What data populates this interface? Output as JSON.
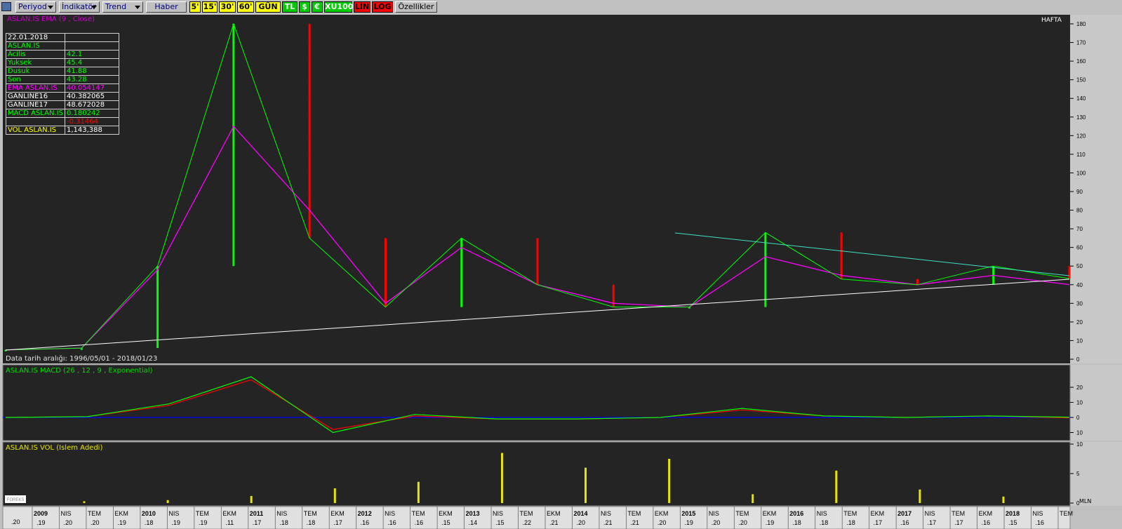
{
  "toolbar": {
    "periyod": "Periyod",
    "indikator": "İndikatör",
    "trend": "Trend",
    "haber": "Haber",
    "chips": [
      "5'",
      "15'",
      "30'",
      "60'",
      "GÜN",
      "TL",
      "$",
      "€",
      "XU100",
      "LİN",
      "LOG",
      "Özellikler"
    ]
  },
  "price_panel": {
    "ema_label": "ASLAN.IS EMA (9 , Close)",
    "period_label": "HAFTA",
    "date_range": "Data tarih aralığı: 1996/05/01 - 2018/01/23",
    "info": {
      "date": "22.01.2018",
      "symbol": "ASLAN.IS",
      "rows": [
        {
          "label": "Acilis",
          "value": "42.1"
        },
        {
          "label": "Yuksek",
          "value": "45.4"
        },
        {
          "label": "Dusuk",
          "value": "41.88"
        },
        {
          "label": "Son",
          "value": "43.28"
        },
        {
          "label": "EMA ASLAN.IS",
          "value": "40.054147"
        },
        {
          "label": "GANLINE16",
          "value": "40.382065"
        },
        {
          "label": "GANLINE17",
          "value": "48.672028"
        },
        {
          "label": "MACD ASLAN.IS",
          "value": "0.180242"
        },
        {
          "label": "",
          "value": "-0.31464"
        },
        {
          "label": "VOL ASLAN.IS",
          "value": "1,143,388"
        }
      ]
    }
  },
  "macd_panel": {
    "label": "ASLAN.IS MACD (26 , 12 , 9 , Exponential)"
  },
  "vol_panel": {
    "label": "ASLAN.IS VOL (Islem Adedi)",
    "unit": "MLN"
  },
  "logo_text": "FOREKS",
  "colors": {
    "bg": "#242424",
    "up": "#00ff00",
    "down": "#ff0000",
    "ema": "#ff00ff",
    "trend_white": "#ffffff",
    "trend_cyan": "#40e0c0",
    "volume": "#e6e600",
    "zero_line": "#0000ff"
  },
  "chart_data": [
    {
      "type": "line",
      "name": "price",
      "title": "ASLAN.IS EMA (9 , Close)",
      "x": [
        "2009",
        "2010",
        "2011",
        "2011",
        "2011",
        "2012",
        "2012",
        "2013",
        "2014",
        "2015",
        "2015",
        "2016",
        "2017",
        "2017",
        "2018"
      ],
      "series": [
        {
          "name": "ASLAN.IS",
          "values": [
            5,
            6,
            50,
            180,
            65,
            28,
            65,
            40,
            28,
            28,
            68,
            43,
            40,
            50,
            43.28
          ]
        },
        {
          "name": "EMA",
          "values": [
            5,
            6,
            48,
            125,
            80,
            30,
            60,
            40,
            30,
            28,
            55,
            45,
            40,
            45,
            40.05
          ]
        }
      ],
      "yticks": [
        0,
        10,
        20,
        30,
        40,
        50,
        60,
        70,
        80,
        90,
        100,
        110,
        120,
        130,
        140,
        150,
        160,
        170,
        180
      ],
      "ylim": [
        0,
        185
      ]
    },
    {
      "type": "line",
      "name": "macd",
      "title": "ASLAN.IS MACD (26 , 12 , 9 , Exponential)",
      "yticks": [
        20,
        10,
        0,
        10
      ],
      "ylim": [
        -13,
        27
      ],
      "series": [
        {
          "name": "MACD",
          "values": [
            0,
            0.5,
            9,
            27,
            -10,
            2,
            -1,
            -1,
            0,
            6,
            1,
            0,
            1,
            0.18
          ]
        },
        {
          "name": "Signal",
          "values": [
            0,
            0.5,
            8,
            25,
            -8,
            1,
            -1,
            -1,
            0,
            5,
            1,
            0,
            1,
            -0.31
          ]
        }
      ]
    },
    {
      "type": "bar",
      "name": "volume",
      "title": "ASLAN.IS VOL (Islem Adedi)",
      "yticks": [
        10,
        5,
        0
      ],
      "ylabel": "MLN",
      "ylim": [
        0,
        10
      ],
      "values": [
        0.3,
        0.5,
        1.2,
        2.5,
        3.6,
        8.5,
        6,
        7.5,
        1.5,
        5.5,
        2.3,
        1.1
      ]
    }
  ],
  "x_axis": {
    "labels": [
      {
        "top": "2009",
        "bottom": ".19",
        "bold": true
      },
      {
        "top": "NIS",
        "bottom": ".20",
        "bold": false
      },
      {
        "top": "TEM",
        "bottom": ".20",
        "bold": false
      },
      {
        "top": "EKM",
        "bottom": ".19",
        "bold": false
      },
      {
        "top": "2010",
        "bottom": ".18",
        "bold": true
      },
      {
        "top": "NIS",
        "bottom": ".19",
        "bold": false
      },
      {
        "top": "TEM",
        "bottom": ".19",
        "bold": false
      },
      {
        "top": "EKM",
        "bottom": ".11",
        "bold": false
      },
      {
        "top": "2011",
        "bottom": ".17",
        "bold": true
      },
      {
        "top": "NIS",
        "bottom": ".18",
        "bold": false
      },
      {
        "top": "TEM",
        "bottom": ".18",
        "bold": false
      },
      {
        "top": "EKM",
        "bottom": ".17",
        "bold": false
      },
      {
        "top": "2012",
        "bottom": ".16",
        "bold": true
      },
      {
        "top": "NIS",
        "bottom": ".16",
        "bold": false
      },
      {
        "top": "TEM",
        "bottom": ".16",
        "bold": false
      },
      {
        "top": "EKM",
        "bottom": ".15",
        "bold": false
      },
      {
        "top": "2013",
        "bottom": ".14",
        "bold": true
      },
      {
        "top": "NIS",
        "bottom": ".15",
        "bold": false
      },
      {
        "top": "TEM",
        "bottom": ".22",
        "bold": false
      },
      {
        "top": "EKM",
        "bottom": ".21",
        "bold": false
      },
      {
        "top": "2014",
        "bottom": ".20",
        "bold": true
      },
      {
        "top": "NIS",
        "bottom": ".21",
        "bold": false
      },
      {
        "top": "TEM",
        "bottom": ".21",
        "bold": false
      },
      {
        "top": "EKM",
        "bottom": ".20",
        "bold": false
      },
      {
        "top": "2015",
        "bottom": ".19",
        "bold": true
      },
      {
        "top": "NIS",
        "bottom": ".20",
        "bold": false
      },
      {
        "top": "TEM",
        "bottom": ".20",
        "bold": false
      },
      {
        "top": "EKM",
        "bottom": ".19",
        "bold": false
      },
      {
        "top": "2016",
        "bottom": ".18",
        "bold": true
      },
      {
        "top": "NIS",
        "bottom": ".18",
        "bold": false
      },
      {
        "top": "TEM",
        "bottom": ".18",
        "bold": false
      },
      {
        "top": "EKM",
        "bottom": ".17",
        "bold": false
      },
      {
        "top": "2017",
        "bottom": ".16",
        "bold": true
      },
      {
        "top": "NIS",
        "bottom": ".17",
        "bold": false
      },
      {
        "top": "TEM",
        "bottom": ".17",
        "bold": false
      },
      {
        "top": "EKM",
        "bottom": ".16",
        "bold": false
      },
      {
        "top": "2018",
        "bottom": ".15",
        "bold": true
      },
      {
        "top": "NIS",
        "bottom": ".16",
        "bold": false
      },
      {
        "top": "TEM",
        "bottom": "",
        "bold": false
      }
    ],
    "first_bottom": ".20"
  }
}
